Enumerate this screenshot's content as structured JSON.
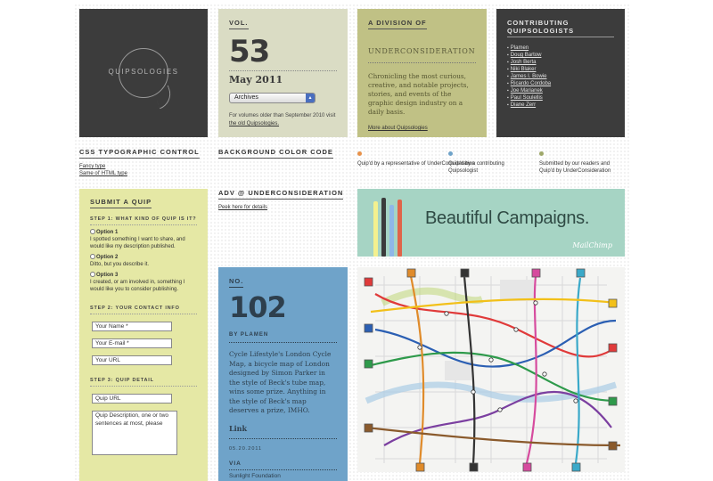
{
  "logo": {
    "text": "QUIPSOLOGIES"
  },
  "vol": {
    "label": "VOL.",
    "number": "53",
    "date": "May 2011",
    "archives_select": "Archives",
    "note": "For volumes older than September 2010 visit",
    "note_link": "the old Quipsologies."
  },
  "division": {
    "label": "A DIVISION OF",
    "brand": "UNDERCONSIDERATION",
    "description": "Chronicling the most curious, creative, and notable projects, stories, and events of the graphic design industry on a daily basis.",
    "more_link": "More about Quipsologies"
  },
  "contributors": {
    "label": "CONTRIBUTING QUIPSOLOGISTS",
    "items": [
      "Plamen",
      "Doug Bartow",
      "Josh Berta",
      "Niki Blaker",
      "James I. Bowie",
      "Ricardo Cordoba",
      "Joe Marianek",
      "Paul Soulellis",
      "Diane Zerr"
    ]
  },
  "css_control": {
    "label": "CSS TYPOGRAPHIC CONTROL",
    "links": [
      "Fancy type",
      "Same ol' HTML type"
    ]
  },
  "bg_code": {
    "label": "BACKGROUND COLOR CODE",
    "items": [
      {
        "color": "#e8924a",
        "text": "Quip'd by a representative of UnderConsideration"
      },
      {
        "color": "#6fa3c9",
        "text": "Quip'd by a contributing Quipsologist"
      },
      {
        "color": "#9fa86a",
        "text": "Submitted by our readers and Quip'd by UnderConsideration"
      }
    ]
  },
  "submit": {
    "label": "SUBMIT A QUIP",
    "step1": "STEP 1: WHAT KIND OF QUIP IS IT?",
    "options": [
      {
        "label": "Option 1",
        "desc": "I spotted something I want to share, and would like my description published."
      },
      {
        "label": "Option 2",
        "desc": "Ditto, but you describe it."
      },
      {
        "label": "Option 3",
        "desc": "I created, or am involved in, something I would like you to consider publishing."
      }
    ],
    "step2": "STEP 2: YOUR CONTACT INFO",
    "name_field": "Your Name *",
    "email_field": "Your E-mail *",
    "url_field": "Your URL",
    "step3": "STEP 3: QUIP DETAIL",
    "quip_url_field": "Quip URL",
    "description_field": "Quip Description, one or two sentences at most, please"
  },
  "adv": {
    "label": "ADV @ UNDERCONSIDERATION",
    "link": "Peek here for details",
    "banner_title": "Beautiful Campaigns.",
    "banner_brand": "MailChimp"
  },
  "quip": {
    "label": "NO.",
    "number": "102",
    "by": "BY PLAMEN",
    "text": "Cycle Lifestyle's London Cycle Map, a bicycle map of London designed by Simon Parker in the style of Beck's tube map, wins some prize. Anything in the style of Beck's map deserves a prize, IMHO.",
    "link": "Link",
    "date": "05.20.2011",
    "via_label": "VIA",
    "via_source": "Sunlight Foundation"
  }
}
